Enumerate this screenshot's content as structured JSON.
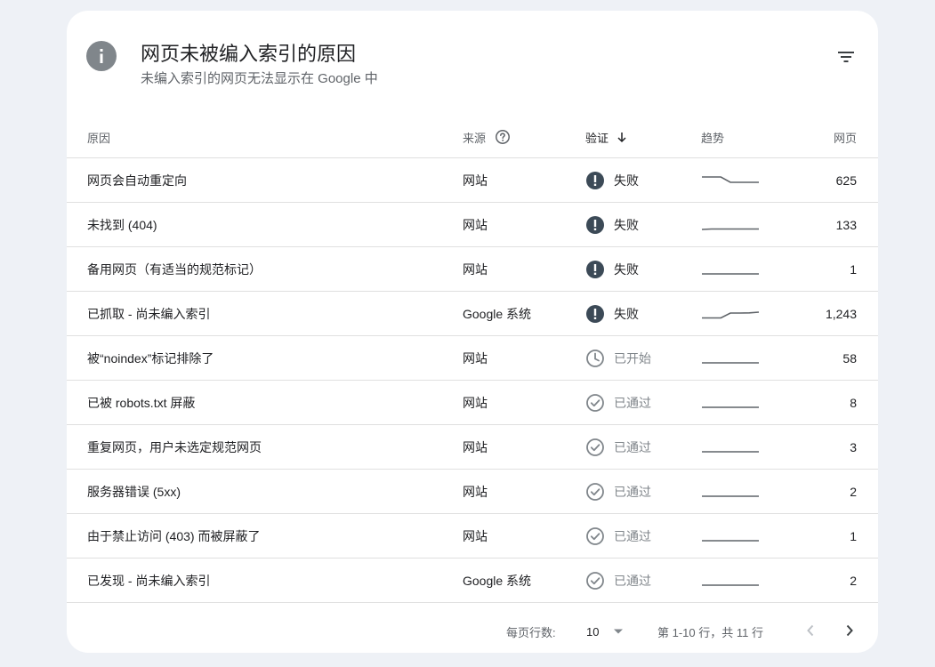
{
  "header": {
    "title": "网页未被编入索引的原因",
    "subtitle": "未编入索引的网页无法显示在 Google 中",
    "info_icon": "info-icon",
    "filter_icon": "filter-icon"
  },
  "table": {
    "columns": {
      "reason": "原因",
      "source": "来源",
      "validation": "验证",
      "trend": "趋势",
      "pages": "网页"
    },
    "rows": [
      {
        "reason": "网页会自动重定向",
        "source": "网站",
        "validation": "失败",
        "status": "failed",
        "trend": [
          0.9,
          0.9,
          0.9,
          0.3,
          0.3,
          0.3,
          0.3
        ],
        "pages": "625"
      },
      {
        "reason": "未找到 (404)",
        "source": "网站",
        "validation": "失败",
        "status": "failed",
        "trend": [
          0.0,
          0.05,
          0.05,
          0.05,
          0.05,
          0.05,
          0.05
        ],
        "pages": "133"
      },
      {
        "reason": "备用网页（有适当的规范标记）",
        "source": "网站",
        "validation": "失败",
        "status": "failed",
        "trend": [
          0,
          0,
          0,
          0,
          0,
          0,
          0
        ],
        "pages": "1"
      },
      {
        "reason": "已抓取 - 尚未编入索引",
        "source": "Google 系统",
        "validation": "失败",
        "status": "failed",
        "trend": [
          0.05,
          0.05,
          0.05,
          0.6,
          0.6,
          0.62,
          0.7
        ],
        "pages": "1,243"
      },
      {
        "reason": "被“noindex”标记排除了",
        "source": "网站",
        "validation": "已开始",
        "status": "started",
        "trend": [
          0,
          0,
          0,
          0,
          0,
          0,
          0
        ],
        "pages": "58"
      },
      {
        "reason": "已被 robots.txt 屏蔽",
        "source": "网站",
        "validation": "已通过",
        "status": "passed",
        "trend": [
          0,
          0,
          0,
          0,
          0,
          0,
          0
        ],
        "pages": "8"
      },
      {
        "reason": "重复网页，用户未选定规范网页",
        "source": "网站",
        "validation": "已通过",
        "status": "passed",
        "trend": [
          0,
          0,
          0,
          0,
          0,
          0,
          0
        ],
        "pages": "3"
      },
      {
        "reason": "服务器错误 (5xx)",
        "source": "网站",
        "validation": "已通过",
        "status": "passed",
        "trend": [
          0,
          0,
          0,
          0,
          0,
          0,
          0
        ],
        "pages": "2"
      },
      {
        "reason": "由于禁止访问 (403) 而被屏蔽了",
        "source": "网站",
        "validation": "已通过",
        "status": "passed",
        "trend": [
          0,
          0,
          0,
          0,
          0,
          0,
          0
        ],
        "pages": "1"
      },
      {
        "reason": "已发现 - 尚未编入索引",
        "source": "Google 系统",
        "validation": "已通过",
        "status": "passed",
        "trend": [
          0,
          0,
          0,
          0,
          0,
          0,
          0
        ],
        "pages": "2"
      }
    ]
  },
  "pagination": {
    "rows_per_page_label": "每页行数:",
    "rows_per_page_value": "10",
    "range_text": "第 1-10 行，共 11 行"
  },
  "colors": {
    "background": "#eef1f6",
    "failed_icon": "#3c4a57",
    "muted": "#80868b",
    "sparkline": "#5f6368"
  }
}
